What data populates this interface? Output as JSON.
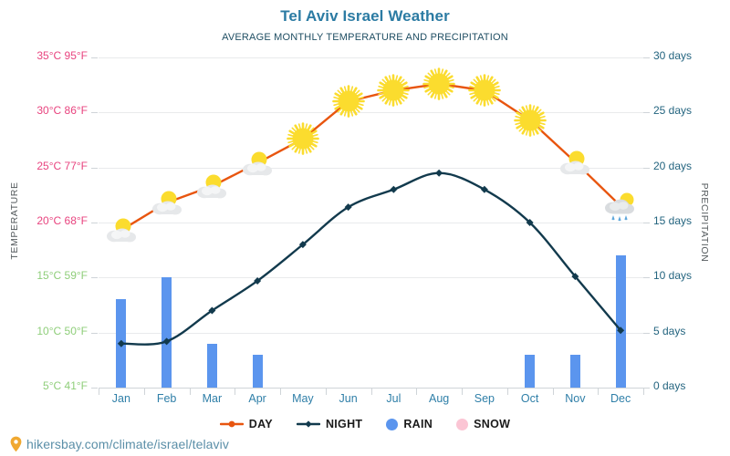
{
  "header": {
    "title": "Tel Aviv Israel Weather",
    "subtitle": "AVERAGE MONTHLY TEMPERATURE AND PRECIPITATION"
  },
  "axes": {
    "left_title": "TEMPERATURE",
    "right_title": "PRECIPITATION",
    "left_ticks": [
      {
        "label": "35°C 95°F",
        "c": 35,
        "color": "#e8447f"
      },
      {
        "label": "30°C 86°F",
        "c": 30,
        "color": "#e8447f"
      },
      {
        "label": "25°C 77°F",
        "c": 25,
        "color": "#e8447f"
      },
      {
        "label": "20°C 68°F",
        "c": 20,
        "color": "#e8447f"
      },
      {
        "label": "15°C 59°F",
        "c": 15,
        "color": "#8fce7a"
      },
      {
        "label": "10°C 50°F",
        "c": 10,
        "color": "#8fce7a"
      },
      {
        "label": "5°C 41°F",
        "c": 5,
        "color": "#8fce7a"
      }
    ],
    "right_ticks": [
      {
        "label": "30 days",
        "d": 30
      },
      {
        "label": "25 days",
        "d": 25
      },
      {
        "label": "20 days",
        "d": 20
      },
      {
        "label": "15 days",
        "d": 15
      },
      {
        "label": "10 days",
        "d": 10
      },
      {
        "label": "5 days",
        "d": 5
      },
      {
        "label": "0 days",
        "d": 0
      }
    ]
  },
  "legend": {
    "items": [
      {
        "label": "DAY",
        "type": "line",
        "color": "#e8550f",
        "icon": "day-line-marker-icon"
      },
      {
        "label": "NIGHT",
        "type": "line",
        "color": "#123a4d",
        "icon": "night-line-marker-icon"
      },
      {
        "label": "RAIN",
        "type": "dot",
        "color": "#5b95ee",
        "icon": "rain-dot-icon"
      },
      {
        "label": "SNOW",
        "type": "dot",
        "color": "#fbc5d4",
        "icon": "snow-dot-icon"
      }
    ]
  },
  "footer": {
    "text": "hikersbay.com/climate/israel/telaviv",
    "pin_icon": "map-pin-icon",
    "pin_color": "#f0a830"
  },
  "chart_data": {
    "type": "line",
    "title": "Tel Aviv Israel Weather",
    "subtitle": "AVERAGE MONTHLY TEMPERATURE AND PRECIPITATION",
    "xlabel": "",
    "ylabel": "TEMPERATURE",
    "y2label": "PRECIPITATION",
    "grid": true,
    "legend_position": "bottom",
    "ylim": [
      5,
      35
    ],
    "y2lim": [
      0,
      30
    ],
    "categories": [
      "Jan",
      "Feb",
      "Mar",
      "Apr",
      "May",
      "Jun",
      "Jul",
      "Aug",
      "Sep",
      "Oct",
      "Nov",
      "Dec"
    ],
    "series": [
      {
        "name": "DAY",
        "unit": "°C",
        "axis": "left",
        "color": "#e8550f",
        "values": [
          19.3,
          21.8,
          23.3,
          25.4,
          27.6,
          31.0,
          32.0,
          32.6,
          32.0,
          29.3,
          25.5,
          21.5
        ]
      },
      {
        "name": "NIGHT",
        "unit": "°C",
        "axis": "left",
        "color": "#123a4d",
        "values": [
          9.0,
          9.2,
          12.0,
          14.7,
          18.0,
          21.4,
          23.0,
          24.5,
          23.0,
          20.0,
          15.1,
          10.2
        ]
      },
      {
        "name": "RAIN",
        "unit": "days",
        "axis": "right",
        "type": "bar",
        "color": "#5b95ee",
        "values": [
          8,
          10,
          4,
          3,
          0,
          0,
          0,
          0,
          0,
          3,
          3,
          12
        ]
      },
      {
        "name": "SNOW",
        "unit": "days",
        "axis": "right",
        "type": "bar",
        "color": "#fbc5d4",
        "values": [
          0,
          0,
          0,
          0,
          0,
          0,
          0,
          0,
          0,
          0,
          0,
          0
        ]
      }
    ],
    "day_icons": [
      "sun-behind-cloud-icon",
      "sun-behind-cloud-icon",
      "sun-behind-cloud-icon",
      "sun-behind-cloud-icon",
      "sun-icon",
      "sun-icon",
      "sun-icon",
      "sun-icon",
      "sun-icon",
      "sun-icon",
      "sun-behind-cloud-icon",
      "sun-behind-rain-cloud-icon"
    ]
  }
}
